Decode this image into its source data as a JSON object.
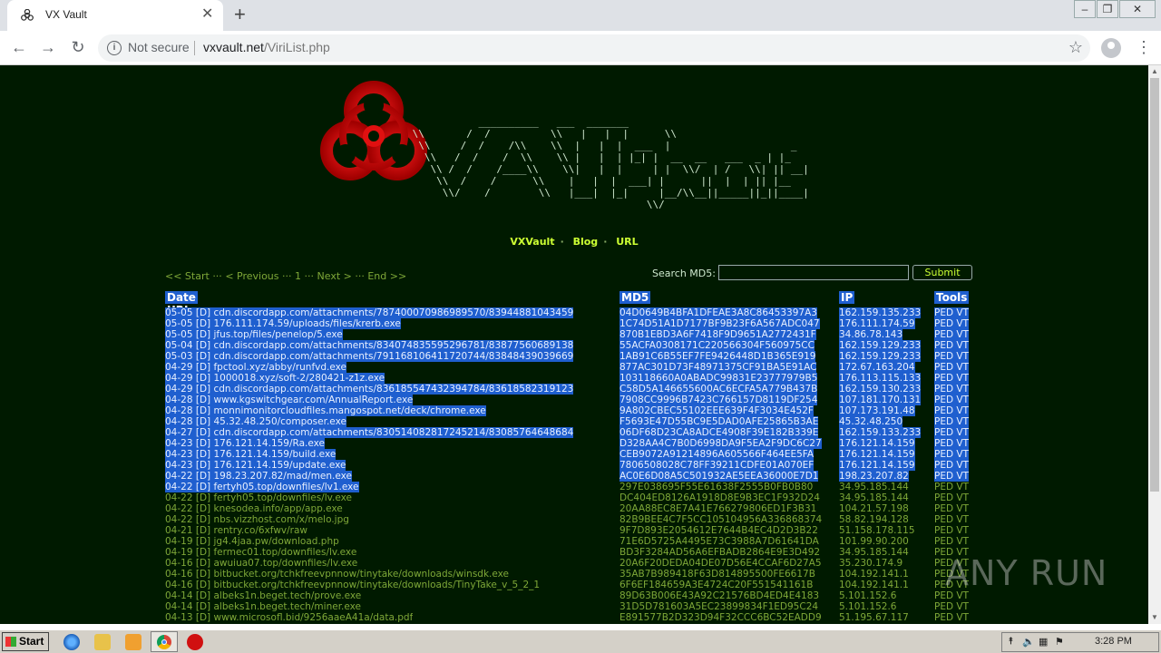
{
  "browser": {
    "tab_title": "VX Vault",
    "omnibox": {
      "security": "Not secure",
      "host": "vxvault.net",
      "path": "/ViriList.php"
    }
  },
  "site": {
    "nav": [
      "VXVault",
      "Blog",
      "URL"
    ],
    "pager": {
      "start": "<< Start",
      "prev": "< Previous",
      "page": "1",
      "next": "Next >",
      "end": "End >>",
      "sep": "···"
    },
    "search_label": "Search MD5:",
    "submit_label": "Submit",
    "columns": [
      "Date URL",
      "MD5",
      "IP",
      "Tools"
    ],
    "rows": [
      {
        "date": "05-05",
        "url": "cdn.discordapp.com/attachments/787400070986989570/83944881043459",
        "md5": "04D0649B4BFA1DFEAE3A8C86453397A3",
        "ip": "162.159.135.233",
        "tools": "PED VT",
        "selected": true
      },
      {
        "date": "05-05",
        "url": "176.111.174.59/uploads/files/krerb.exe",
        "md5": "1C74D51A1D7177BF9B23F6A567ADC047",
        "ip": "176.111.174.59",
        "tools": "PED VT",
        "selected": true
      },
      {
        "date": "05-05",
        "url": "jfus.top/files/penelop/5.exe",
        "md5": "870B1EBD3A6F7418F9D9651A2772431F",
        "ip": "34.86.78.143",
        "tools": "PED VT",
        "selected": true
      },
      {
        "date": "05-04",
        "url": "cdn.discordapp.com/attachments/834074835595296781/83877560689138",
        "md5": "55ACFA0308171C220566304F560975CC",
        "ip": "162.159.129.233",
        "tools": "PED VT",
        "selected": true
      },
      {
        "date": "05-03",
        "url": "cdn.discordapp.com/attachments/791168106411720744/83848439039669",
        "md5": "1AB91C6B55EF7FE9426448D1B365E919",
        "ip": "162.159.129.233",
        "tools": "PED VT",
        "selected": true
      },
      {
        "date": "04-29",
        "url": "fpctool.xyz/abby/runfvd.exe",
        "md5": "877AC301D73F48971375CF91BA5E91AC",
        "ip": "172.67.163.204",
        "tools": "PED VT",
        "selected": true
      },
      {
        "date": "04-29",
        "url": "1000018.xyz/soft-2/280421-z1z.exe",
        "md5": "103118660A0ABADC99831E23777979B5",
        "ip": "176.113.115.133",
        "tools": "PED VT",
        "selected": true
      },
      {
        "date": "04-29",
        "url": "cdn.discordapp.com/attachments/836185547432394784/83618582319123",
        "md5": "C58D5A146655600AC6ECFA5A779B437B",
        "ip": "162.159.130.233",
        "tools": "PED VT",
        "selected": true
      },
      {
        "date": "04-28",
        "url": "www.kgswitchgear.com/AnnualReport.exe",
        "md5": "7908CC9996B7423C766157D8119DF254",
        "ip": "107.181.170.131",
        "tools": "PED VT",
        "selected": true
      },
      {
        "date": "04-28",
        "url": "monnimonitorcloudfiles.mangospot.net/deck/chrome.exe",
        "md5": "9A802CBEC55102EEE639F4F3034E452F",
        "ip": "107.173.191.48",
        "tools": "PED VT",
        "selected": true
      },
      {
        "date": "04-28",
        "url": "45.32.48.250/composer.exe",
        "md5": "F5693E47D55BC9E5DAD0AFE25865B3AE",
        "ip": "45.32.48.250",
        "tools": "PED VT",
        "selected": true
      },
      {
        "date": "04-27",
        "url": "cdn.discordapp.com/attachments/830514082817245214/83085764648684",
        "md5": "06DF68D23CA8ADCE4908F39E182B339E",
        "ip": "162.159.133.233",
        "tools": "PED VT",
        "selected": true
      },
      {
        "date": "04-23",
        "url": "176.121.14.159/Ra.exe",
        "md5": "D328AA4C7B0D6998DA9F5EA2F9DC6C27",
        "ip": "176.121.14.159",
        "tools": "PED VT",
        "selected": true
      },
      {
        "date": "04-23",
        "url": "176.121.14.159/build.exe",
        "md5": "CEB9072A91214896A605566F464EE5FA",
        "ip": "176.121.14.159",
        "tools": "PED VT",
        "selected": true
      },
      {
        "date": "04-23",
        "url": "176.121.14.159/update.exe",
        "md5": "7806508028C78FF39211CDFE01A070EF",
        "ip": "176.121.14.159",
        "tools": "PED VT",
        "selected": true
      },
      {
        "date": "04-22",
        "url": "198.23.207.82/mad/men.exe",
        "md5": "AC0E6D08A5C501932AE5EEA36000E7D1",
        "ip": "198.23.207.82",
        "tools": "PED VT",
        "selected": true
      },
      {
        "date": "04-22",
        "url": "fertyh05.top/downfiles/lv1.exe",
        "md5": "297E038695F55E61638F2555B0FB0B80",
        "ip": "34.95.185.144",
        "tools": "PED VT",
        "selected": "partial"
      },
      {
        "date": "04-22",
        "url": "fertyh05.top/downfiles/lv.exe",
        "md5": "DC404ED8126A1918D8E9B3EC1F932D24",
        "ip": "34.95.185.144",
        "tools": "PED VT",
        "selected": false
      },
      {
        "date": "04-22",
        "url": "knesodea.info/app/app.exe",
        "md5": "20AA88EC8E7A41E766279806ED1F3B31",
        "ip": "104.21.57.198",
        "tools": "PED VT",
        "selected": false
      },
      {
        "date": "04-22",
        "url": "nbs.vizzhost.com/x/melo.jpg",
        "md5": "82B9BEE4C7F5CC105104956A336868374",
        "ip": "58.82.194.128",
        "tools": "PED VT",
        "selected": false
      },
      {
        "date": "04-21",
        "url": "rentry.co/6xfwv/raw",
        "md5": "9F7D893E2054612E7644B4EC4D2D3B22",
        "ip": "51.158.178.115",
        "tools": "PED VT",
        "selected": false
      },
      {
        "date": "04-19",
        "url": "jg4.4jaa.pw/download.php",
        "md5": "71E6D5725A4495E73C3988A7D61641DA",
        "ip": "101.99.90.200",
        "tools": "PED VT",
        "selected": false
      },
      {
        "date": "04-19",
        "url": "fermec01.top/downfiles/lv.exe",
        "md5": "BD3F3284AD56A6EFBADB2864E9E3D492",
        "ip": "34.95.185.144",
        "tools": "PED VT",
        "selected": false
      },
      {
        "date": "04-16",
        "url": "awuiua07.top/downfiles/lv.exe",
        "md5": "20A6F20DEDA04DE07D56E4CCAF6D27A5",
        "ip": "35.230.174.9",
        "tools": "PED VT",
        "selected": false
      },
      {
        "date": "04-16",
        "url": "bitbucket.org/tchkfreevpnnow/tinytake/downloads/winsdk.exe",
        "md5": "35AB7B989418F63D814895500FE6617B",
        "ip": "104.192.141.1",
        "tools": "PED VT",
        "selected": false
      },
      {
        "date": "04-16",
        "url": "bitbucket.org/tchkfreevpnnow/tinytake/downloads/TinyTake_v_5_2_1",
        "md5": "6F6EF184659A3E4724C20F551541161B",
        "ip": "104.192.141.1",
        "tools": "PED VT",
        "selected": false
      },
      {
        "date": "04-14",
        "url": "albeks1n.beget.tech/prove.exe",
        "md5": "89D63B006E43A92C21576BD4ED4E4183",
        "ip": "5.101.152.6",
        "tools": "PED VT",
        "selected": false
      },
      {
        "date": "04-14",
        "url": "albeks1n.beget.tech/miner.exe",
        "md5": "31D5D781603A5EC23899834F1ED95C24",
        "ip": "5.101.152.6",
        "tools": "PED VT",
        "selected": false
      },
      {
        "date": "04-13",
        "url": "www.microsofl.bid/9256aaeA41a/data.pdf",
        "md5": "E891577B2D323D94F32CCC6BC52EADD9",
        "ip": "51.195.67.117",
        "tools": "PED VT",
        "selected": false
      }
    ]
  },
  "watermark": "ANY RUN",
  "taskbar": {
    "start": "Start",
    "clock": "3:28 PM"
  },
  "colors": {
    "page_bg": "#001a00",
    "link": "#7fa838",
    "nav": "#ccff33",
    "selection": "#1f5fcf"
  }
}
